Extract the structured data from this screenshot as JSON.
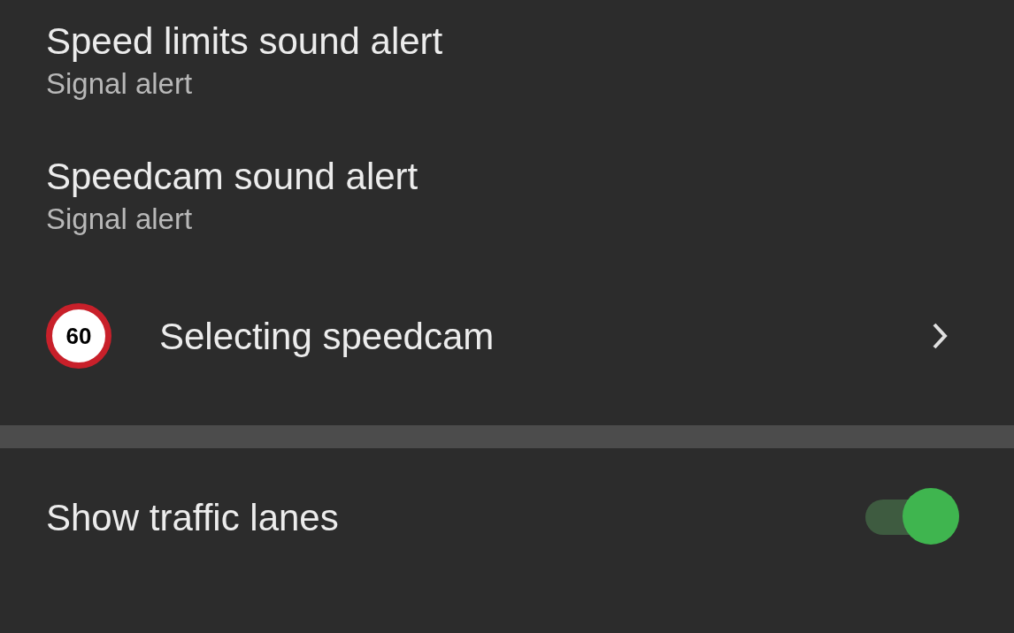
{
  "settings": [
    {
      "kind": "sound",
      "title": "Speed limits sound alert",
      "subtitle": "Signal alert"
    },
    {
      "kind": "sound",
      "title": "Speedcam sound alert",
      "subtitle": "Signal alert"
    },
    {
      "kind": "link",
      "title": "Selecting speedcam",
      "sign": "60"
    }
  ],
  "toggles": [
    {
      "title": "Show traffic lanes",
      "on": true
    }
  ]
}
